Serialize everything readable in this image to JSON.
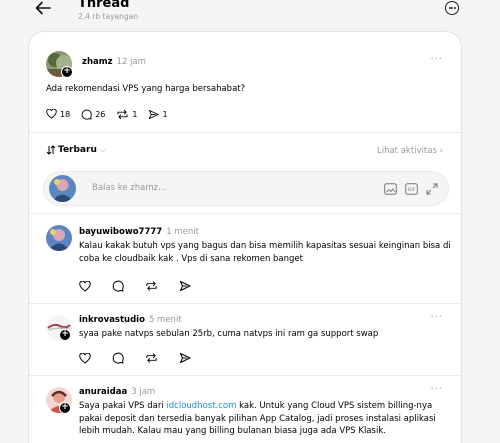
{
  "header": {
    "title": "Thread",
    "views": "2,4 rb tayangan"
  },
  "post": {
    "username": "zhamz",
    "time": "12 jam",
    "text": "Ada rekomendasi VPS yang harga bersahabat?",
    "likes": "18",
    "comments": "26",
    "reposts": "1",
    "shares": "1"
  },
  "sort": {
    "label": "Terbaru",
    "activity": "Lihat aktivitas"
  },
  "reply": {
    "placeholder": "Balas ke zhamz..."
  },
  "comments": [
    {
      "username": "bayuwibowo7777",
      "time": "1 menit",
      "text": "Kalau kakak butuh vps yang bagus dan bisa memilih kapasitas sesuai keinginan bisa di coba ke cloudbaik kak . Vps di sana rekomen banget"
    },
    {
      "username": "inkrovastudio",
      "time": "5 menit",
      "text": "syaa pake natvps sebulan 25rb, cuma natvps ini ram ga support swap"
    },
    {
      "username": "anuraidaa",
      "time": "3 jam",
      "text_before": "Saya pakai VPS dari ",
      "link": "idcloudhost.com",
      "text_after": " kak. Untuk yang Cloud VPS sistem billing-nya pakai deposit dan tersedia banyak pilihan App Catalog, jadi proses instalasi aplikasi lebih mudah. Kalau mau yang billing bulanan biasa juga ada VPS Klasik."
    }
  ],
  "colors": {
    "link": "#1d8fd6",
    "muted": "#999999"
  }
}
